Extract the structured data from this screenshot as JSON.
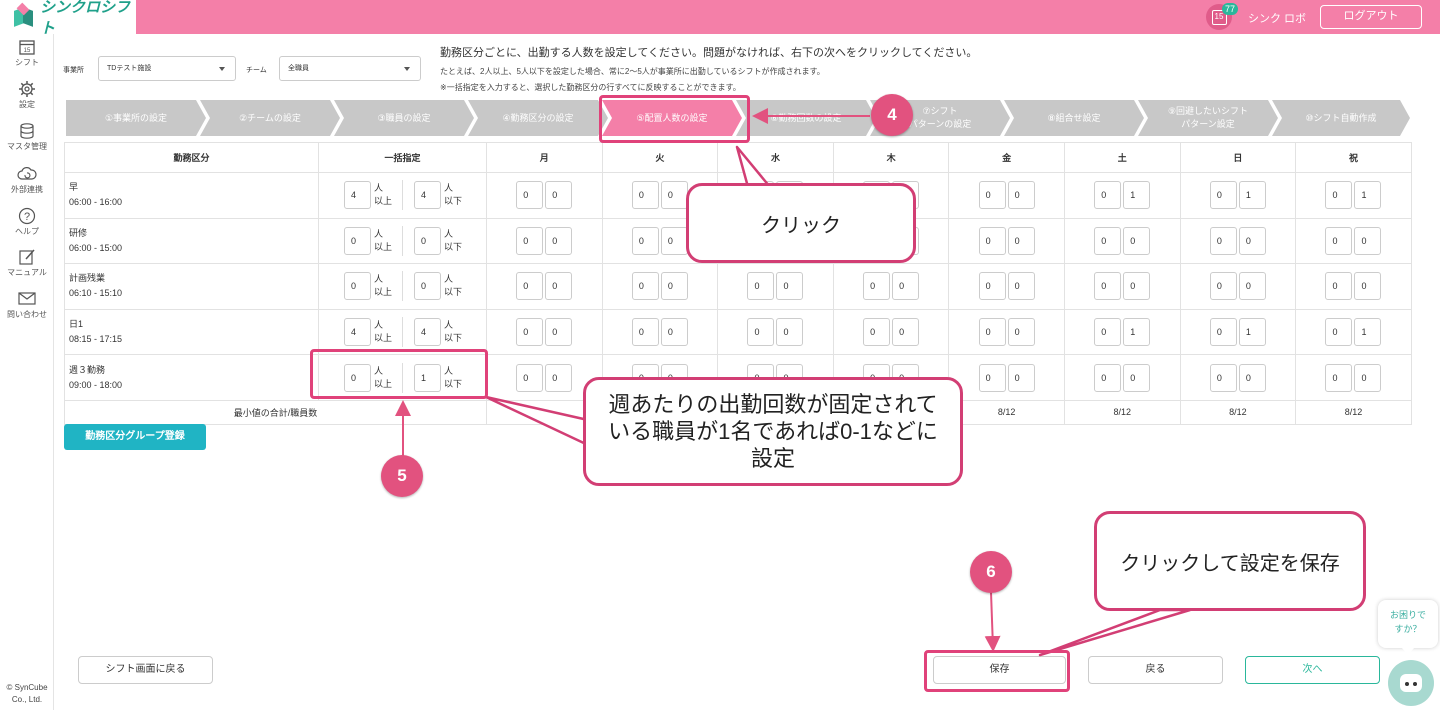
{
  "header": {
    "logo": "シンクロシフト",
    "notification_count": "77",
    "calendar_date": "15",
    "user_name": "シンク ロボ",
    "logout_label": "ログアウト"
  },
  "sidebar": {
    "items": [
      {
        "label": "シフト",
        "icon": "calendar-icon"
      },
      {
        "label": "設定",
        "icon": "gear-icon"
      },
      {
        "label": "マスタ管理",
        "icon": "database-icon"
      },
      {
        "label": "外部連携",
        "icon": "cloud-sync-icon"
      },
      {
        "label": "ヘルプ",
        "icon": "help-icon"
      },
      {
        "label": "マニュアル",
        "icon": "manual-icon"
      },
      {
        "label": "問い合わせ",
        "icon": "mail-icon"
      }
    ],
    "copyright_line1": "© SynCube",
    "copyright_line2": "Co., Ltd."
  },
  "filters": {
    "office_label": "事業所",
    "office_value": "TDテスト施設",
    "team_label": "チーム",
    "team_value": "全職員"
  },
  "instructions": {
    "line1": "勤務区分ごとに、出勤する人数を設定してください。問題がなければ、右下の次へをクリックしてください。",
    "line2": "たとえば、2人以上、5人以下を設定した場合、常に2〜5人が事業所に出勤しているシフトが作成されます。",
    "line3": "※一括指定を入力すると、選択した勤務区分の行すべてに反映することができます。"
  },
  "steps": [
    {
      "label": "①事業所の設定"
    },
    {
      "label": "②チームの設定"
    },
    {
      "label": "③職員の設定"
    },
    {
      "label": "④勤務区分の設定"
    },
    {
      "label": "⑤配置人数の設定"
    },
    {
      "label": "⑥勤務回数の設定"
    },
    {
      "label": "⑦シフト\nパターンの設定"
    },
    {
      "label": "⑧組合せ設定"
    },
    {
      "label": "⑨回避したいシフト\nパターン設定"
    },
    {
      "label": "⑩シフト自動作成"
    }
  ],
  "table": {
    "headers": [
      "勤務区分",
      "一括指定",
      "月",
      "火",
      "水",
      "木",
      "金",
      "土",
      "日",
      "祝"
    ],
    "unit_top": "人",
    "unit_min": "以上",
    "unit_max": "以下",
    "rows": [
      {
        "name": "早",
        "time": "06:00 - 16:00",
        "bulk_min": "4",
        "bulk_max": "4",
        "days": [
          [
            "0",
            "0"
          ],
          [
            "0",
            "0"
          ],
          [
            "0",
            "0"
          ],
          [
            "0",
            "0"
          ],
          [
            "0",
            "0"
          ],
          [
            "0",
            "1"
          ],
          [
            "0",
            "1"
          ],
          [
            "0",
            "1"
          ]
        ]
      },
      {
        "name": "研修",
        "time": "06:00 - 15:00",
        "bulk_min": "0",
        "bulk_max": "0",
        "days": [
          [
            "0",
            "0"
          ],
          [
            "0",
            "0"
          ],
          [
            "0",
            "0"
          ],
          [
            "0",
            "0"
          ],
          [
            "0",
            "0"
          ],
          [
            "0",
            "0"
          ],
          [
            "0",
            "0"
          ],
          [
            "0",
            "0"
          ]
        ]
      },
      {
        "name": "計画残業",
        "time": "06:10 - 15:10",
        "bulk_min": "0",
        "bulk_max": "0",
        "days": [
          [
            "0",
            "0"
          ],
          [
            "0",
            "0"
          ],
          [
            "0",
            "0"
          ],
          [
            "0",
            "0"
          ],
          [
            "0",
            "0"
          ],
          [
            "0",
            "0"
          ],
          [
            "0",
            "0"
          ],
          [
            "0",
            "0"
          ]
        ]
      },
      {
        "name": "日1",
        "time": "08:15 - 17:15",
        "bulk_min": "4",
        "bulk_max": "4",
        "days": [
          [
            "0",
            "0"
          ],
          [
            "0",
            "0"
          ],
          [
            "0",
            "0"
          ],
          [
            "0",
            "0"
          ],
          [
            "0",
            "0"
          ],
          [
            "0",
            "1"
          ],
          [
            "0",
            "1"
          ],
          [
            "0",
            "1"
          ]
        ]
      },
      {
        "name": "週３勤務",
        "time": "09:00 - 18:00",
        "bulk_min": "0",
        "bulk_max": "1",
        "days": [
          [
            "0",
            "0"
          ],
          [
            "0",
            "0"
          ],
          [
            "0",
            "0"
          ],
          [
            "0",
            "0"
          ],
          [
            "0",
            "0"
          ],
          [
            "0",
            "0"
          ],
          [
            "0",
            "0"
          ],
          [
            "0",
            "0"
          ]
        ]
      }
    ],
    "summary_label": "最小値の合計/職員数",
    "summary_values": [
      "8/12",
      "8/12",
      "8/12",
      "8/12",
      "8/12"
    ]
  },
  "buttons": {
    "group_register": "勤務区分グループ登録",
    "back_to_shift": "シフト画面に戻る",
    "save": "保存",
    "back": "戻る",
    "next": "次へ"
  },
  "help": {
    "line1": "お困りで",
    "line2": "すか？"
  },
  "annotations": {
    "step4_number": "4",
    "step4_text": "クリック",
    "step5_number": "5",
    "step5_text": "週あたりの出勤回数が固定されている職員が1名であれば0-1などに設定",
    "step6_number": "6",
    "step6_text": "クリックして設定を保存",
    "color": "#e2527f"
  },
  "colors": {
    "brand_pink": "#f47fa8",
    "accent_teal": "#2ab79b",
    "group_button": "#20b4c4",
    "step_inactive": "#c8c8c8"
  }
}
